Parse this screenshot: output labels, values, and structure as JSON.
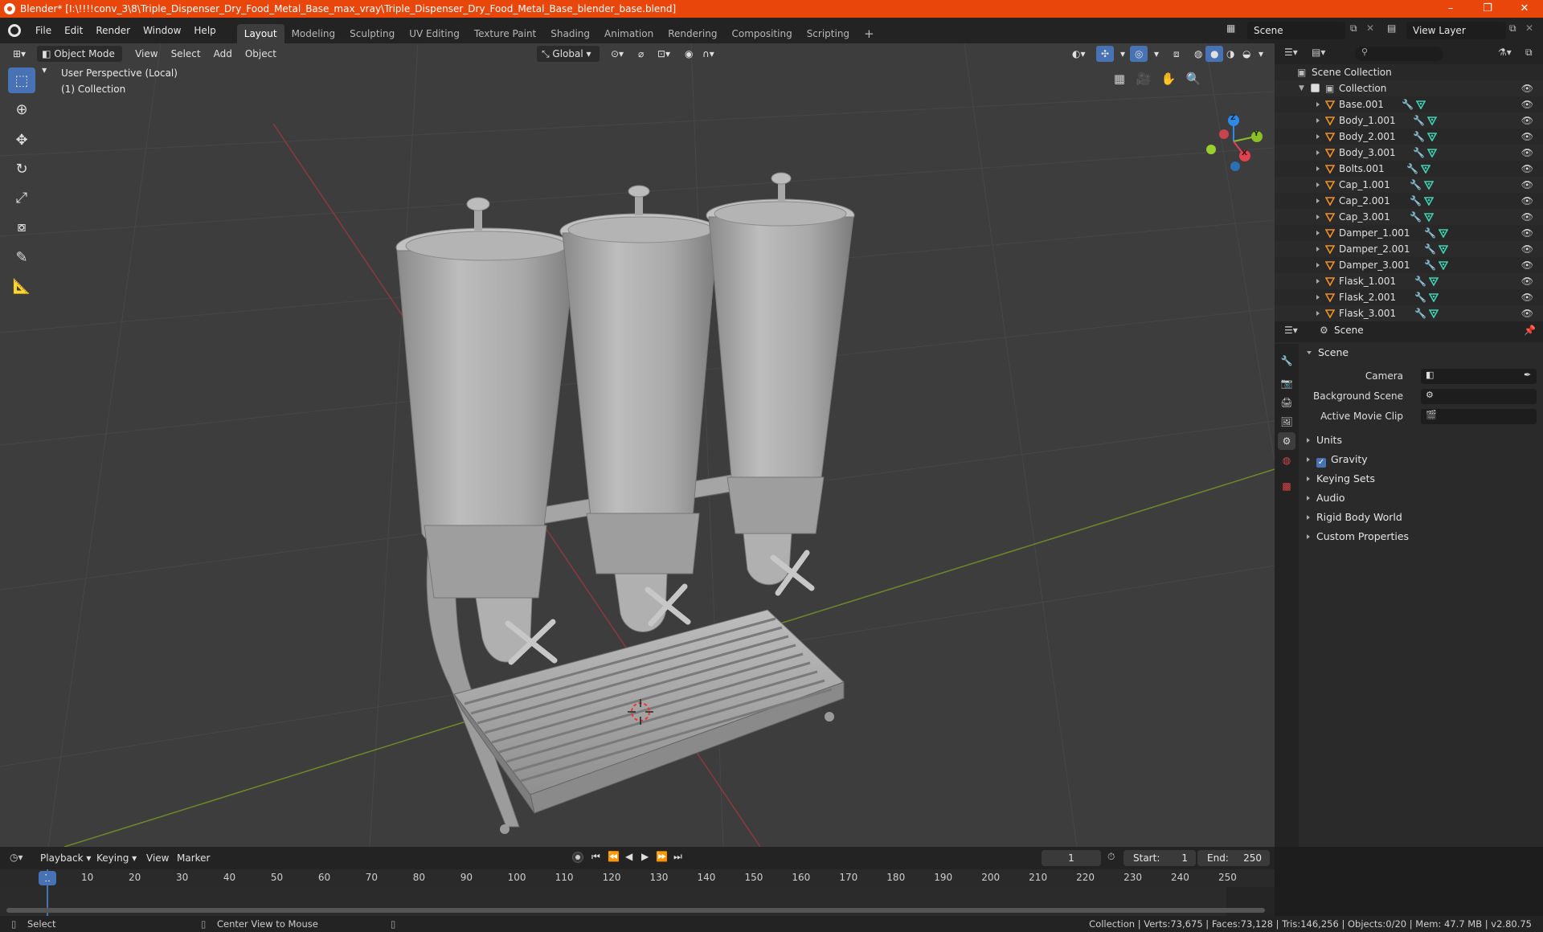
{
  "window": {
    "title": "Blender* [I:\\!!!!conv_3\\8\\Triple_Dispenser_Dry_Food_Metal_Base_max_vray\\Triple_Dispenser_Dry_Food_Metal_Base_blender_base.blend]",
    "minimize": "–",
    "maximize": "❐",
    "close": "✕"
  },
  "menu": [
    "File",
    "Edit",
    "Render",
    "Window",
    "Help"
  ],
  "workspaces": [
    "Layout",
    "Modeling",
    "Sculpting",
    "UV Editing",
    "Texture Paint",
    "Shading",
    "Animation",
    "Rendering",
    "Compositing",
    "Scripting"
  ],
  "workspace_add": "+",
  "scene_selector": "Scene",
  "view_layer": "View Layer",
  "viewport": {
    "mode": "Object Mode",
    "menus": [
      "View",
      "Select",
      "Add",
      "Object"
    ],
    "transform_orientation": "Global",
    "perspective_label": "User Perspective (Local)",
    "collection_label": "(1) Collection",
    "gizmo": {
      "x": "X",
      "y": "Y",
      "z": "Z"
    }
  },
  "outliner": {
    "root": "Scene Collection",
    "collection": "Collection",
    "items": [
      "Base.001",
      "Body_1.001",
      "Body_2.001",
      "Body_3.001",
      "Bolts.001",
      "Cap_1.001",
      "Cap_2.001",
      "Cap_3.001",
      "Damper_1.001",
      "Damper_2.001",
      "Damper_3.001",
      "Flask_1.001",
      "Flask_2.001",
      "Flask_3.001"
    ]
  },
  "properties": {
    "context": "Scene",
    "section_scene": "Scene",
    "camera_label": "Camera",
    "background_scene_label": "Background Scene",
    "active_movie_clip_label": "Active Movie Clip",
    "units": "Units",
    "gravity": "Gravity",
    "keying_sets": "Keying Sets",
    "audio": "Audio",
    "rigid_body_world": "Rigid Body World",
    "custom_properties": "Custom Properties"
  },
  "timeline": {
    "menus": [
      "Playback",
      "Keying",
      "View",
      "Marker"
    ],
    "current_frame": "1",
    "start_label": "Start:",
    "start": "1",
    "end_label": "End:",
    "end": "250",
    "ticks": [
      "1",
      "10",
      "20",
      "30",
      "40",
      "50",
      "60",
      "70",
      "80",
      "90",
      "100",
      "110",
      "120",
      "130",
      "140",
      "150",
      "160",
      "170",
      "180",
      "190",
      "200",
      "210",
      "220",
      "230",
      "240",
      "250"
    ]
  },
  "status": {
    "left": "Select",
    "middle": "Center View to Mouse",
    "right": "Collection | Verts:73,675 | Faces:73,128 | Tris:146,256 | Objects:0/20 | Mem: 47.7 MB | v2.80.75"
  },
  "colors": {
    "title_bar": "#e8460a",
    "accent_blue": "#4772b3",
    "axis_x": "#e0424f",
    "axis_y": "#8cbf26",
    "axis_z": "#2e8ae6",
    "mesh_icon": "#3fd3b4",
    "object_icon": "#f0912b"
  }
}
